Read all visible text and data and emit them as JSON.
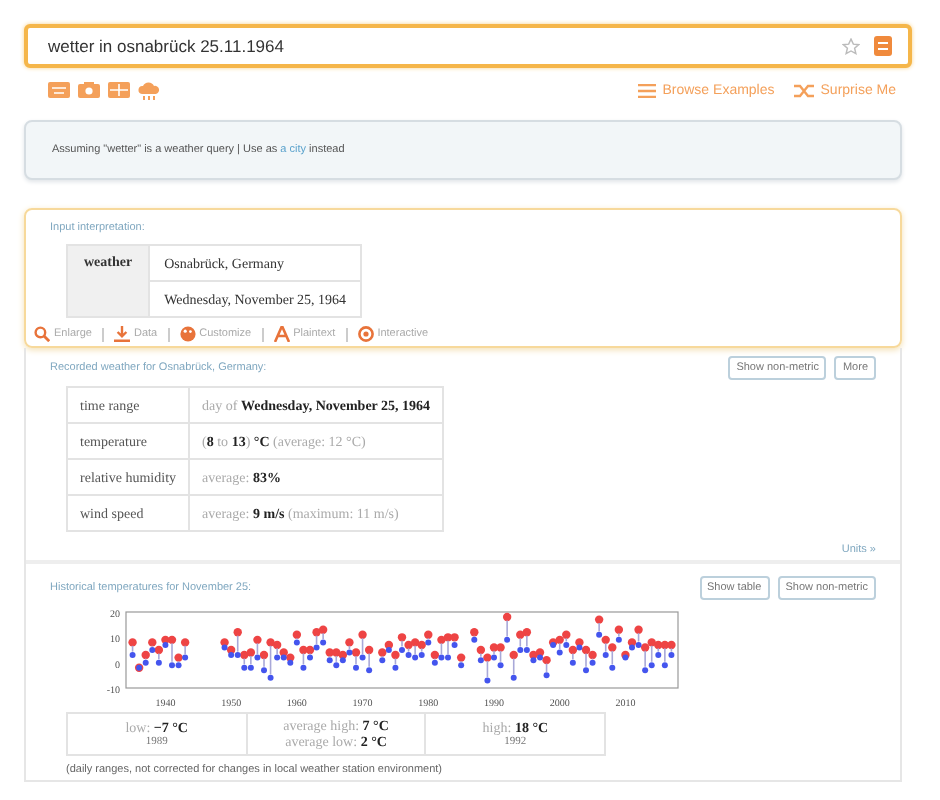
{
  "search": {
    "value": "wetter in osnabrück 25.11.1964"
  },
  "links": [
    {
      "kind": "browse",
      "label": "Browse Examples"
    },
    {
      "kind": "shuffle",
      "label": "Surprise Me"
    }
  ],
  "assumption": {
    "prefix": "Assuming \"wetter\" is a weather query | Use as ",
    "link": "a city",
    "suffix": " instead"
  },
  "interpretation": {
    "title": "Input interpretation:",
    "label": "weather",
    "values": [
      "Osnabrück, Germany",
      "Wednesday, November 25, 1964"
    ],
    "actions": [
      {
        "kind": "enlarge",
        "label": "Enlarge"
      },
      {
        "kind": "data",
        "label": "Data"
      },
      {
        "kind": "customize",
        "label": "Customize"
      },
      {
        "kind": "plaintext",
        "label": "Plaintext"
      },
      {
        "kind": "interactive",
        "label": "Interactive"
      }
    ]
  },
  "recorded": {
    "title": "Recorded weather for Osnabrück, Germany:",
    "buttons": [
      "Show non-metric",
      "More"
    ],
    "rows": [
      {
        "label": "time range",
        "parts": [
          {
            "text": "day of ",
            "strong": false
          },
          {
            "text": "Wednesday, November 25, 1964",
            "strong": true
          }
        ]
      },
      {
        "label": "temperature",
        "parts": [
          {
            "text": "(",
            "strong": false
          },
          {
            "text": "8",
            "strong": true
          },
          {
            "text": " to ",
            "strong": false
          },
          {
            "text": "13",
            "strong": true
          },
          {
            "text": ")",
            "strong": false
          },
          {
            "text": " °C",
            "strong": true
          },
          {
            "text": " (average: 12 °C)",
            "strong": false
          }
        ]
      },
      {
        "label": "relative humidity",
        "parts": [
          {
            "text": "average: ",
            "strong": false
          },
          {
            "text": "83%",
            "strong": true
          }
        ]
      },
      {
        "label": "wind speed",
        "parts": [
          {
            "text": "average: ",
            "strong": false
          },
          {
            "text": "9 m/s",
            "strong": true
          },
          {
            "text": " (maximum: 11 m/s)",
            "strong": false
          }
        ]
      }
    ],
    "units_link": "Units »"
  },
  "historical": {
    "title": "Historical temperatures for November 25:",
    "buttons": [
      "Show table",
      "Show non-metric"
    ],
    "chart_data": {
      "type": "scatter",
      "xlim": [
        1934,
        2018
      ],
      "ylim": [
        -10,
        20
      ],
      "xticks": [
        1940,
        1950,
        1960,
        1970,
        1980,
        1990,
        2000,
        2010
      ],
      "yticks": [
        -10,
        0,
        10,
        20
      ],
      "x": [
        1935,
        1936,
        1937,
        1938,
        1939,
        1940,
        1941,
        1942,
        1943,
        1949,
        1950,
        1951,
        1952,
        1953,
        1954,
        1955,
        1956,
        1957,
        1958,
        1959,
        1960,
        1961,
        1962,
        1963,
        1964,
        1965,
        1966,
        1967,
        1968,
        1969,
        1970,
        1971,
        1973,
        1974,
        1975,
        1976,
        1977,
        1978,
        1979,
        1980,
        1981,
        1982,
        1983,
        1984,
        1985,
        1987,
        1988,
        1989,
        1990,
        1991,
        1992,
        1993,
        1994,
        1995,
        1996,
        1997,
        1998,
        1999,
        2000,
        2001,
        2002,
        2003,
        2004,
        2005,
        2006,
        2007,
        2008,
        2009,
        2010,
        2011,
        2012,
        2013,
        2014,
        2015,
        2016,
        2017
      ],
      "series": [
        {
          "color": "#ee4444",
          "values": [
            8,
            -2,
            3,
            8,
            5,
            9,
            9,
            2,
            8,
            8,
            5,
            12,
            3,
            4,
            9,
            3,
            8,
            7,
            4,
            2,
            11,
            5,
            5,
            12,
            13,
            4,
            4,
            3,
            8,
            4,
            11,
            5,
            4,
            7,
            3,
            10,
            7,
            8,
            7,
            11,
            3,
            9,
            10,
            10,
            2,
            12,
            5,
            2,
            6,
            6,
            18,
            3,
            11,
            12,
            3,
            4,
            1,
            8,
            9,
            11,
            5,
            8,
            5,
            3,
            17,
            9,
            6,
            13,
            3,
            8,
            13,
            6,
            8,
            7,
            7,
            7
          ]
        },
        {
          "color": "#4455ee",
          "values": [
            3,
            -2,
            0,
            5,
            0,
            7,
            -1,
            -1,
            2,
            6,
            3,
            3,
            -2,
            -2,
            2,
            -3,
            -6,
            2,
            2,
            0,
            8,
            -2,
            2,
            6,
            8,
            1,
            -1,
            1,
            4,
            -2,
            2,
            -3,
            1,
            5,
            -2,
            5,
            3,
            2,
            3,
            8,
            0,
            2,
            2,
            7,
            -1,
            9,
            1,
            -7,
            2,
            -1,
            9,
            -6,
            5,
            5,
            1,
            2,
            -5,
            7,
            4,
            7,
            0,
            6,
            -3,
            0,
            11,
            3,
            -2,
            9,
            2,
            6,
            7,
            -3,
            -1,
            3,
            -1,
            3
          ]
        }
      ]
    },
    "stats": [
      {
        "lines": [
          {
            "label": "low: ",
            "value": "−7 °C"
          }
        ],
        "year": "1989"
      },
      {
        "lines": [
          {
            "label": "average high: ",
            "value": "7 °C"
          },
          {
            "label": "average low: ",
            "value": "2 °C"
          }
        ]
      },
      {
        "lines": [
          {
            "label": "high: ",
            "value": "18 °C"
          }
        ],
        "year": "1992"
      }
    ],
    "note": "(daily ranges, not corrected for changes in local weather station environment)"
  }
}
